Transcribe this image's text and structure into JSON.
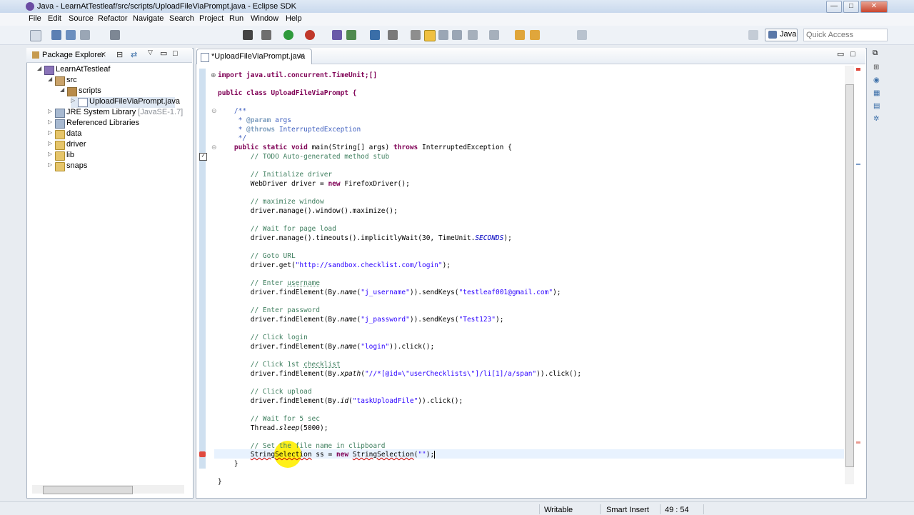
{
  "window": {
    "title": "Java - LearnAtTestleaf/src/scripts/UploadFileViaPrompt.java - Eclipse SDK",
    "min": "—",
    "max": "□",
    "close": "✕"
  },
  "menu": [
    "File",
    "Edit",
    "Source",
    "Refactor",
    "Navigate",
    "Search",
    "Project",
    "Run",
    "Window",
    "Help"
  ],
  "toolbar": {
    "perspective_label": "Java",
    "quick_access_placeholder": "Quick Access"
  },
  "package_explorer": {
    "tab_label": "Package Explorer",
    "tree": [
      {
        "label": "LearnAtTestleaf",
        "icon": "project-icon",
        "expanded": true
      },
      {
        "label": "src",
        "icon": "source-folder-icon",
        "expanded": true
      },
      {
        "label": "scripts",
        "icon": "package-icon",
        "expanded": true
      },
      {
        "label": "UploadFileViaPrompt.java",
        "icon": "java-file-icon",
        "expanded": false
      },
      {
        "label": "JRE System Library",
        "decoration": "[JavaSE-1.7]",
        "icon": "library-icon",
        "expanded": false
      },
      {
        "label": "Referenced Libraries",
        "icon": "library-icon",
        "expanded": false
      },
      {
        "label": "data",
        "icon": "folder-icon",
        "expanded": false
      },
      {
        "label": "driver",
        "icon": "folder-icon",
        "expanded": false
      },
      {
        "label": "lib",
        "icon": "folder-icon",
        "expanded": false
      },
      {
        "label": "snaps",
        "icon": "folder-icon",
        "expanded": false
      }
    ]
  },
  "editor": {
    "tab_label": "*UploadFileViaPrompt.java",
    "code": {
      "l01": "import java.util.concurrent.TimeUnit;[]",
      "l02": "public class UploadFileViaPrompt {",
      "l03": "    /**",
      "l04a": "     * ",
      "l04b": "@param",
      "l04c": " args",
      "l05a": "     * ",
      "l05b": "@throws",
      "l05c": " InterruptedException",
      "l06": "     */",
      "l07a": "    public static void ",
      "l07b": "main(String[] args) ",
      "l07c": "throws",
      "l07d": " InterruptedException {",
      "l08": "        // TODO Auto-generated method stub",
      "l09": "        // Initialize driver",
      "l10a": "        WebDriver driver = ",
      "l10b": "new",
      "l10c": " FirefoxDriver();",
      "l11": "        // maximize window",
      "l12": "        driver.manage().window().maximize();",
      "l13": "        // Wait for page load",
      "l14a": "        driver.manage().timeouts().implicitlyWait(30, TimeUnit.",
      "l14b": "SECONDS",
      "l14c": ");",
      "l15": "        // Goto URL",
      "l16a": "        driver.get(",
      "l16b": "\"http://sandbox.checklist.com/login\"",
      "l16c": ");",
      "l17a": "        // Enter ",
      "l17b": "username",
      "l18a": "        driver.findElement(By.",
      "l18b": "name",
      "l18c": "(",
      "l18d": "\"j_username\"",
      "l18e": ")).sendKeys(",
      "l18f": "\"testleaf001@gmail.com\"",
      "l18g": ");",
      "l19": "        // Enter password",
      "l20a": "        driver.findElement(By.",
      "l20b": "name",
      "l20c": "(",
      "l20d": "\"j_password\"",
      "l20e": ")).sendKeys(",
      "l20f": "\"Test123\"",
      "l20g": ");",
      "l21": "        // Click login",
      "l22a": "        driver.findElement(By.",
      "l22b": "name",
      "l22c": "(",
      "l22d": "\"login\"",
      "l22e": ")).click();",
      "l23a": "        // Click 1st ",
      "l23b": "checklist",
      "l24a": "        driver.findElement(By.",
      "l24b": "xpath",
      "l24c": "(",
      "l24d": "\"//*[@id=\\\"userChecklists\\\"]/li[1]/a/span\"",
      "l24e": ")).click();",
      "l25": "        // Click upload",
      "l26a": "        driver.findElement(By.",
      "l26b": "id",
      "l26c": "(",
      "l26d": "\"taskUploadFile\"",
      "l26e": ")).click();",
      "l27": "        // Wait for 5 sec",
      "l28a": "        Thread.",
      "l28b": "sleep",
      "l28c": "(5000);",
      "l29": "        // Set the file name in clipboard",
      "l30a": "        ",
      "l30b": "StringSelection",
      "l30c": " ss = ",
      "l30d": "new",
      "l30e": " ",
      "l30f": "StringSelection",
      "l30g": "(",
      "l30h": "\"\"",
      "l30i": ");",
      "l31": "    }",
      "l32": "}"
    }
  },
  "status": {
    "writable": "Writable",
    "insert_mode": "Smart Insert",
    "position": "49 : 54"
  }
}
